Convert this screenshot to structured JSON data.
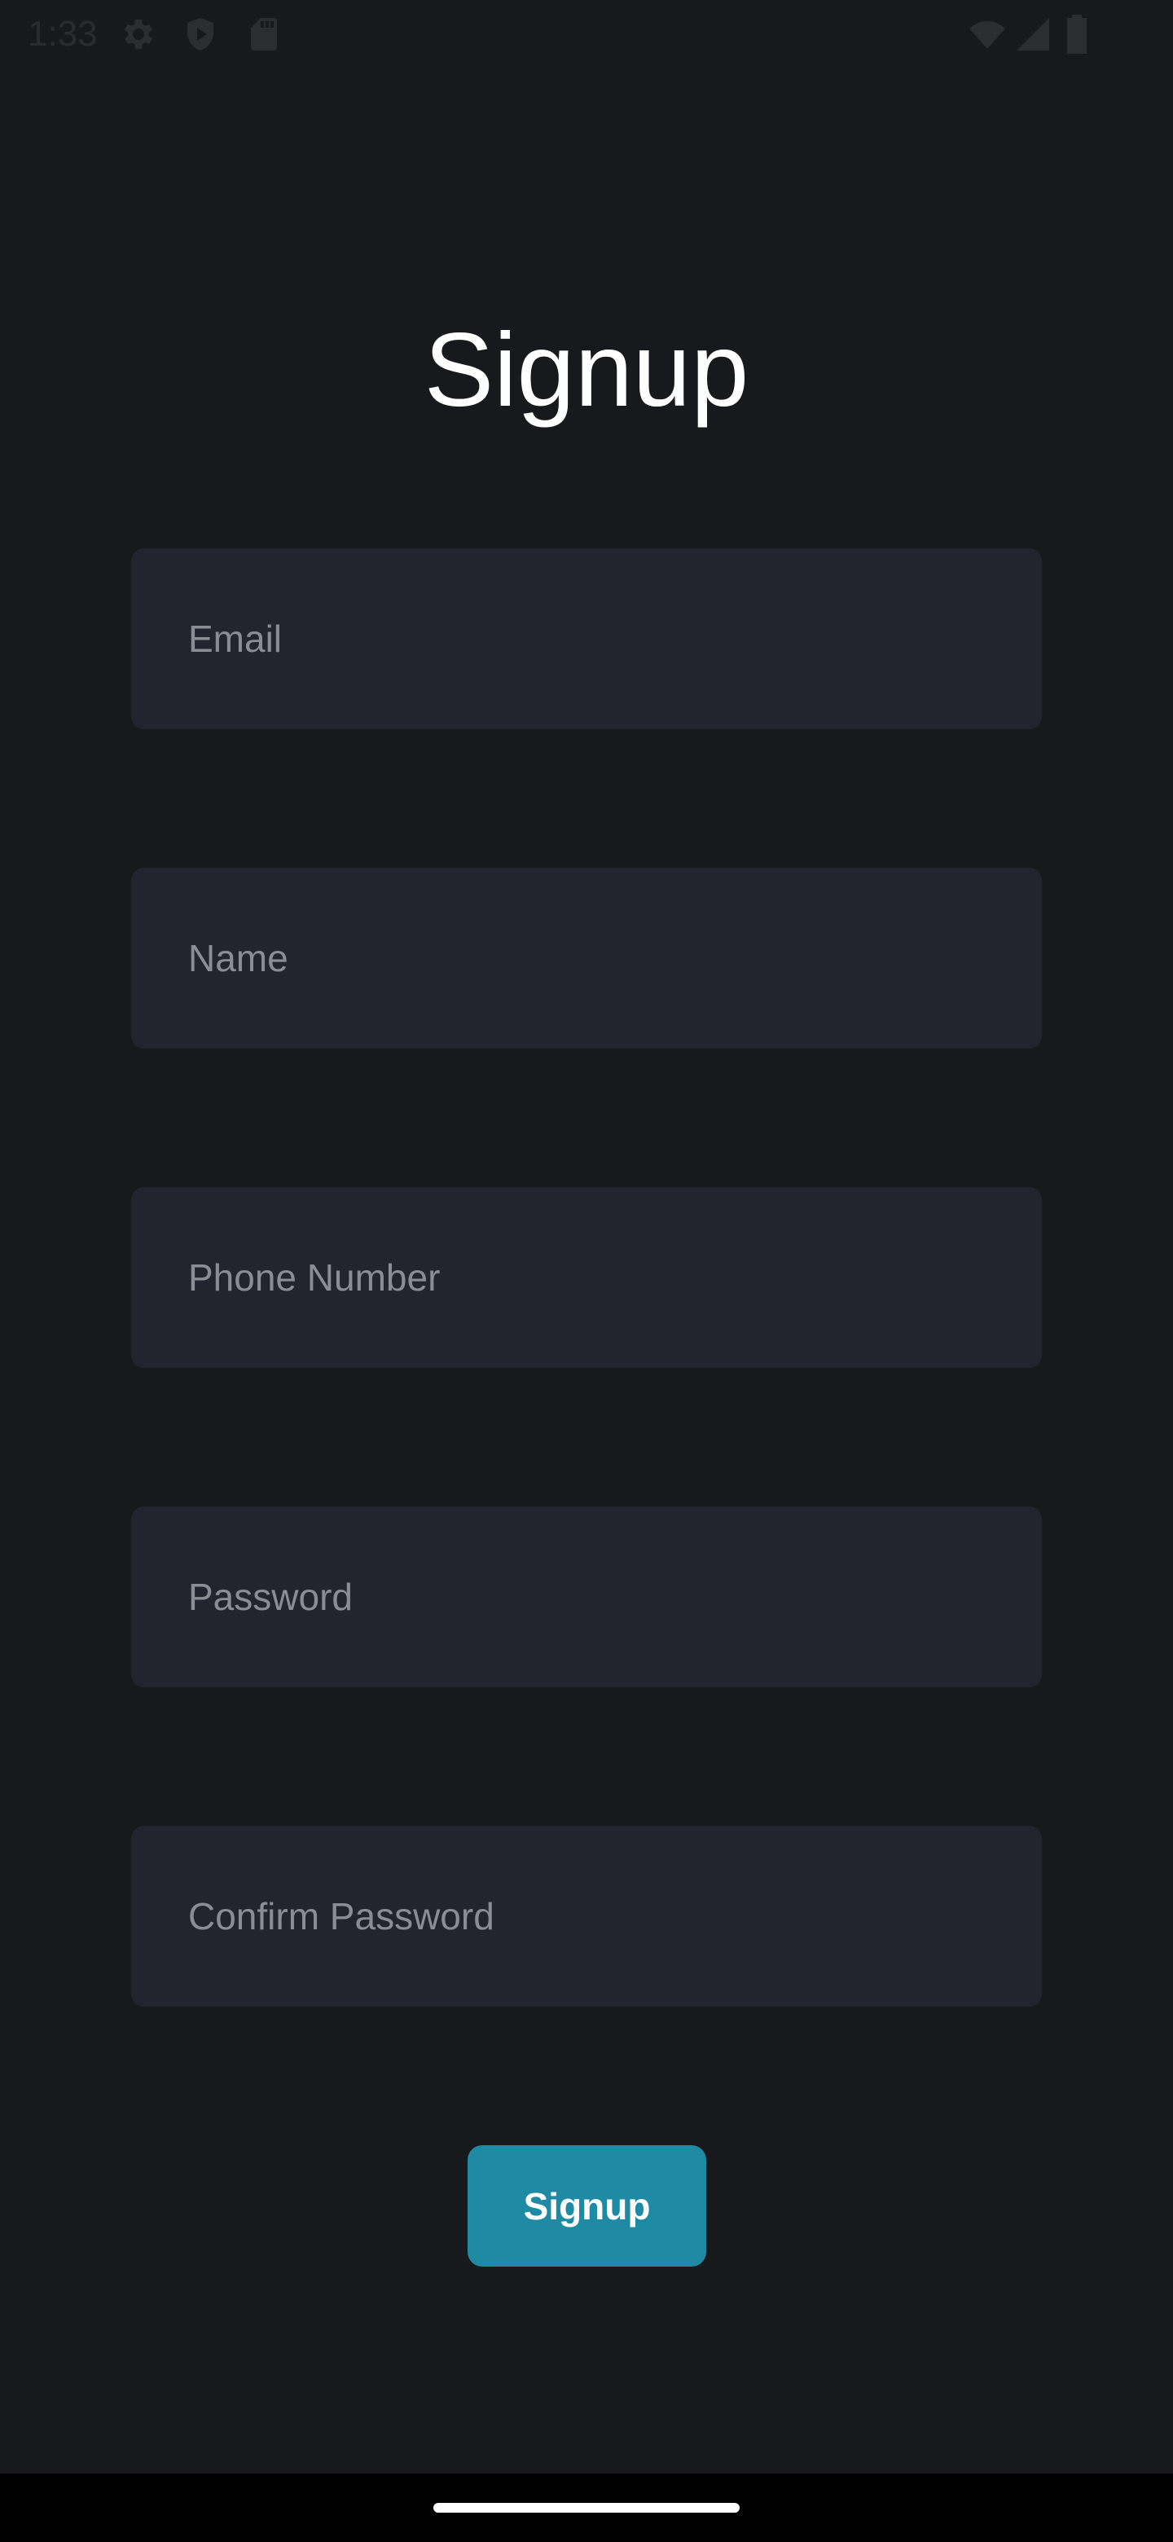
{
  "status_bar": {
    "time": "1:33",
    "icons": [
      "settings-icon",
      "play-protect-icon",
      "sd-card-icon",
      "wifi-icon",
      "signal-icon",
      "battery-icon"
    ]
  },
  "page": {
    "title": "Signup"
  },
  "form": {
    "email_placeholder": "Email",
    "name_placeholder": "Name",
    "phone_placeholder": "Phone Number",
    "password_placeholder": "Password",
    "confirm_password_placeholder": "Confirm Password",
    "signup_label": "Signup"
  },
  "colors": {
    "background": "#18191d",
    "field_background": "#23252e",
    "placeholder": "#8b8d94",
    "button": "#1e8aa4",
    "text": "#ffffff"
  }
}
